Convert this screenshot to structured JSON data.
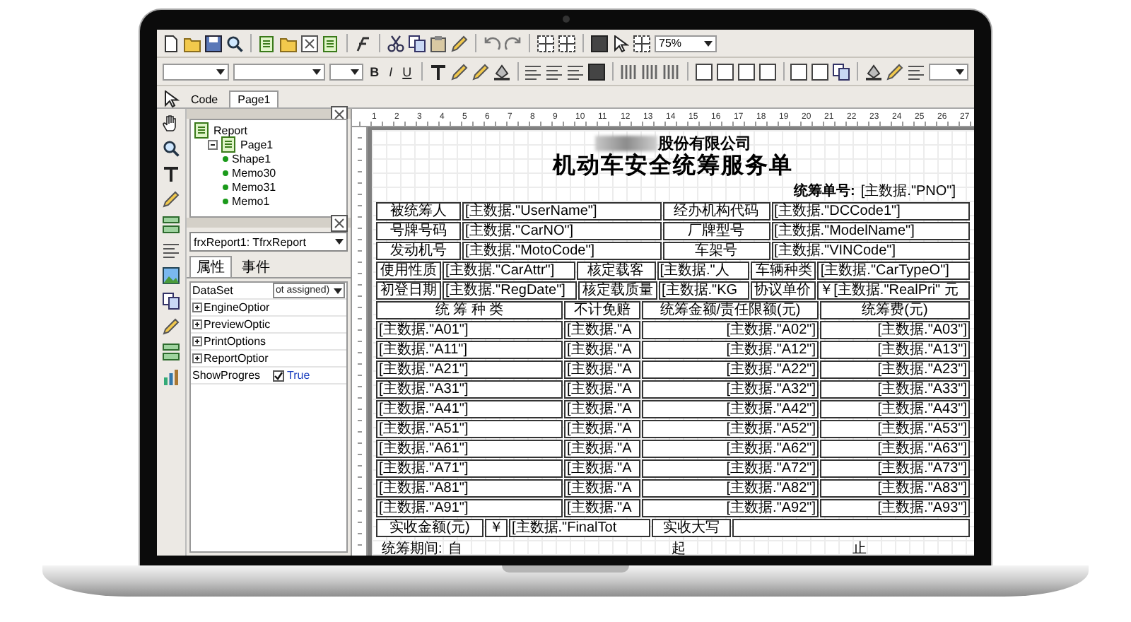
{
  "toolbar": {
    "zoom": "75%",
    "format_buttons": [
      "B",
      "I",
      "U"
    ]
  },
  "tabs": [
    {
      "label": "Code",
      "selected": false
    },
    {
      "label": "Page1",
      "selected": true
    }
  ],
  "tree": [
    {
      "label": "Report",
      "children": [
        {
          "label": "Page1",
          "expanded": true,
          "children": [
            {
              "label": "Shape1"
            },
            {
              "label": "Memo30"
            },
            {
              "label": "Memo31"
            },
            {
              "label": "Memo1"
            }
          ]
        }
      ]
    }
  ],
  "object_selector": "frxReport1: TfrxReport",
  "inspector_tabs": [
    {
      "label": "属性",
      "selected": true
    },
    {
      "label": "事件",
      "selected": false
    }
  ],
  "properties": [
    {
      "kind": "dropdown",
      "name": "DataSet",
      "value": "ot assigned)"
    },
    {
      "kind": "group",
      "name": "EngineOptior",
      "expanded": false
    },
    {
      "kind": "group",
      "name": "PreviewOptic",
      "expanded": false
    },
    {
      "kind": "group",
      "name": "PrintOptions",
      "expanded": false
    },
    {
      "kind": "group",
      "name": "ReportOptior",
      "expanded": false
    },
    {
      "kind": "check",
      "name": "ShowProgres",
      "checked": true,
      "value": "True"
    }
  ],
  "ruler": [
    "1",
    "2",
    "3",
    "4",
    "5",
    "6",
    "7",
    "8",
    "9",
    "10",
    "11",
    "12",
    "13",
    "14",
    "15",
    "16",
    "17",
    "18",
    "19",
    "20",
    "21",
    "22",
    "23",
    "24",
    "25",
    "26",
    "27"
  ],
  "report": {
    "company": "股份有限公司",
    "title": "机动车安全统筹服务单",
    "number_label": "统筹单号:",
    "number_field": "[主数据.\"PNO\"]",
    "rows": [
      {
        "kind": "info2",
        "cells": [
          {
            "kind": "label",
            "text": "被统筹人"
          },
          {
            "kind": "field",
            "text": "[主数据.\"UserName\"]"
          },
          {
            "kind": "label",
            "text": "经办机构代码"
          },
          {
            "kind": "field",
            "text": "[主数据.\"DCCode1\"]"
          }
        ]
      },
      {
        "kind": "info2",
        "cells": [
          {
            "kind": "label",
            "text": "号牌号码"
          },
          {
            "kind": "field",
            "text": "[主数据.\"CarNO\"]"
          },
          {
            "kind": "label",
            "text": "厂牌型号"
          },
          {
            "kind": "field",
            "text": "[主数据.\"ModelName\"]"
          }
        ]
      },
      {
        "kind": "info2",
        "cells": [
          {
            "kind": "label",
            "text": "发动机号"
          },
          {
            "kind": "field",
            "text": "[主数据.\"MotoCode\"]"
          },
          {
            "kind": "label",
            "text": "车架号"
          },
          {
            "kind": "field",
            "text": "[主数据.\"VINCode\"]"
          }
        ]
      },
      {
        "kind": "info3",
        "cells": [
          {
            "kind": "label",
            "text": "使用性质"
          },
          {
            "kind": "field",
            "text": "[主数据.\"CarAttr\"]"
          },
          {
            "kind": "label",
            "text": "核定载客"
          },
          {
            "kind": "field",
            "text": "[主数据.\"人"
          },
          {
            "kind": "label",
            "text": "车辆种类"
          },
          {
            "kind": "field",
            "text": "[主数据.\"CarTypeO\"]"
          }
        ]
      },
      {
        "kind": "info3",
        "cells": [
          {
            "kind": "label",
            "text": "初登日期"
          },
          {
            "kind": "field",
            "text": "[主数据.\"RegDate\"]"
          },
          {
            "kind": "label",
            "text": "核定载质量"
          },
          {
            "kind": "field",
            "text": "[主数据.\"KG"
          },
          {
            "kind": "label",
            "text": "协议单价"
          },
          {
            "kind": "field",
            "text": "￥[主数据.\"RealPri\" 元"
          }
        ]
      },
      {
        "kind": "header",
        "cells": [
          {
            "kind": "label",
            "text": "统 筹 种 类"
          },
          {
            "kind": "label",
            "text": "不计免赔"
          },
          {
            "kind": "label",
            "text": "统筹金额/责任限额(元)"
          },
          {
            "kind": "label",
            "text": "统筹费(元)"
          }
        ]
      },
      {
        "kind": "item",
        "cells": [
          {
            "kind": "field",
            "text": "[主数据.\"A01\"]"
          },
          {
            "kind": "field",
            "text": "[主数据.\"A"
          },
          {
            "kind": "amount",
            "text": "[主数据.\"A02\"]"
          },
          {
            "kind": "amount",
            "text": "[主数据.\"A03\"]"
          }
        ]
      },
      {
        "kind": "item",
        "cells": [
          {
            "kind": "field",
            "text": "[主数据.\"A11\"]"
          },
          {
            "kind": "field",
            "text": "[主数据.\"A"
          },
          {
            "kind": "amount",
            "text": "[主数据.\"A12\"]"
          },
          {
            "kind": "amount",
            "text": "[主数据.\"A13\"]"
          }
        ]
      },
      {
        "kind": "item",
        "cells": [
          {
            "kind": "field",
            "text": "[主数据.\"A21\"]"
          },
          {
            "kind": "field",
            "text": "[主数据.\"A"
          },
          {
            "kind": "amount",
            "text": "[主数据.\"A22\"]"
          },
          {
            "kind": "amount",
            "text": "[主数据.\"A23\"]"
          }
        ]
      },
      {
        "kind": "item",
        "cells": [
          {
            "kind": "field",
            "text": "[主数据.\"A31\"]"
          },
          {
            "kind": "field",
            "text": "[主数据.\"A"
          },
          {
            "kind": "amount",
            "text": "[主数据.\"A32\"]"
          },
          {
            "kind": "amount",
            "text": "[主数据.\"A33\"]"
          }
        ]
      },
      {
        "kind": "item",
        "cells": [
          {
            "kind": "field",
            "text": "[主数据.\"A41\"]"
          },
          {
            "kind": "field",
            "text": "[主数据.\"A"
          },
          {
            "kind": "amount",
            "text": "[主数据.\"A42\"]"
          },
          {
            "kind": "amount",
            "text": "[主数据.\"A43\"]"
          }
        ]
      },
      {
        "kind": "item",
        "cells": [
          {
            "kind": "field",
            "text": "[主数据.\"A51\"]"
          },
          {
            "kind": "field",
            "text": "[主数据.\"A"
          },
          {
            "kind": "amount",
            "text": "[主数据.\"A52\"]"
          },
          {
            "kind": "amount",
            "text": "[主数据.\"A53\"]"
          }
        ]
      },
      {
        "kind": "item",
        "cells": [
          {
            "kind": "field",
            "text": "[主数据.\"A61\"]"
          },
          {
            "kind": "field",
            "text": "[主数据.\"A"
          },
          {
            "kind": "amount",
            "text": "[主数据.\"A62\"]"
          },
          {
            "kind": "amount",
            "text": "[主数据.\"A63\"]"
          }
        ]
      },
      {
        "kind": "item",
        "cells": [
          {
            "kind": "field",
            "text": "[主数据.\"A71\"]"
          },
          {
            "kind": "field",
            "text": "[主数据.\"A"
          },
          {
            "kind": "amount",
            "text": "[主数据.\"A72\"]"
          },
          {
            "kind": "amount",
            "text": "[主数据.\"A73\"]"
          }
        ]
      },
      {
        "kind": "item",
        "cells": [
          {
            "kind": "field",
            "text": "[主数据.\"A81\"]"
          },
          {
            "kind": "field",
            "text": "[主数据.\"A"
          },
          {
            "kind": "amount",
            "text": "[主数据.\"A82\"]"
          },
          {
            "kind": "amount",
            "text": "[主数据.\"A83\"]"
          }
        ]
      },
      {
        "kind": "item",
        "cells": [
          {
            "kind": "field",
            "text": "[主数据.\"A91\"]"
          },
          {
            "kind": "field",
            "text": "[主数据.\"A"
          },
          {
            "kind": "amount",
            "text": "[主数据.\"A92\"]"
          },
          {
            "kind": "amount",
            "text": "[主数据.\"A93\"]"
          }
        ]
      },
      {
        "kind": "total",
        "cells": [
          {
            "kind": "label",
            "text": "实收金额(元)"
          },
          {
            "kind": "label",
            "text": "￥"
          },
          {
            "kind": "field",
            "text": "[主数据.\"FinalTot"
          },
          {
            "kind": "label",
            "text": "实收大写"
          }
        ]
      }
    ],
    "period": {
      "label": "统筹期间:",
      "from": "自",
      "start": "起",
      "end": "止"
    }
  }
}
